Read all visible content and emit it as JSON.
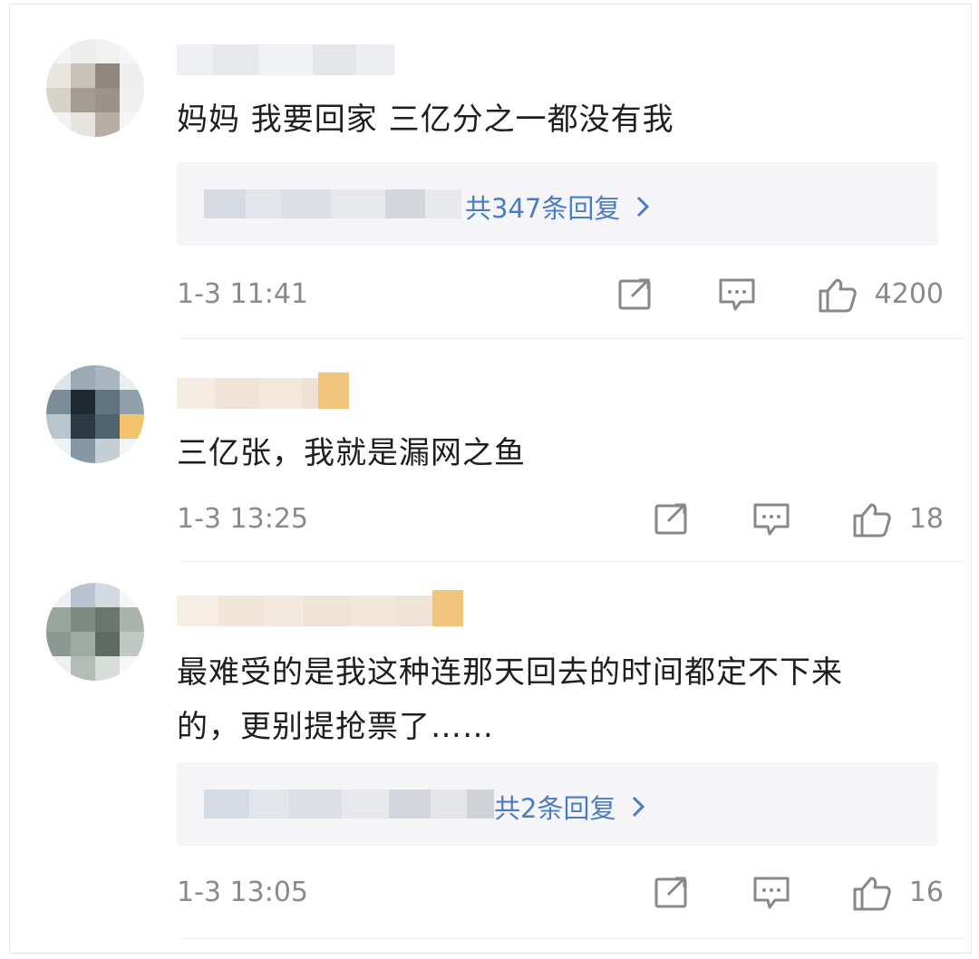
{
  "comments": [
    {
      "text": "妈妈 我要回家 三亿分之一都没有我",
      "reply_link": "共347条回复",
      "time": "1-3 11:41",
      "likes": "4200"
    },
    {
      "text": "三亿张，我就是漏网之鱼",
      "time": "1-3 13:25",
      "likes": "18"
    },
    {
      "text_line1": "最难受的是我这种连那天回去的时间都定不下来",
      "text_line2": "的，更别提抢票了……",
      "reply_link": "共2条回复",
      "time": "1-3 13:05",
      "likes": "16"
    }
  ],
  "icons": {
    "share": "share-icon",
    "comment": "comment-icon",
    "like": "like-icon",
    "chevron": "chevron-right-icon"
  },
  "colors": {
    "link": "#4a7cc4",
    "meta": "#8a8a8a",
    "reply_bg": "#f5f5f7"
  }
}
